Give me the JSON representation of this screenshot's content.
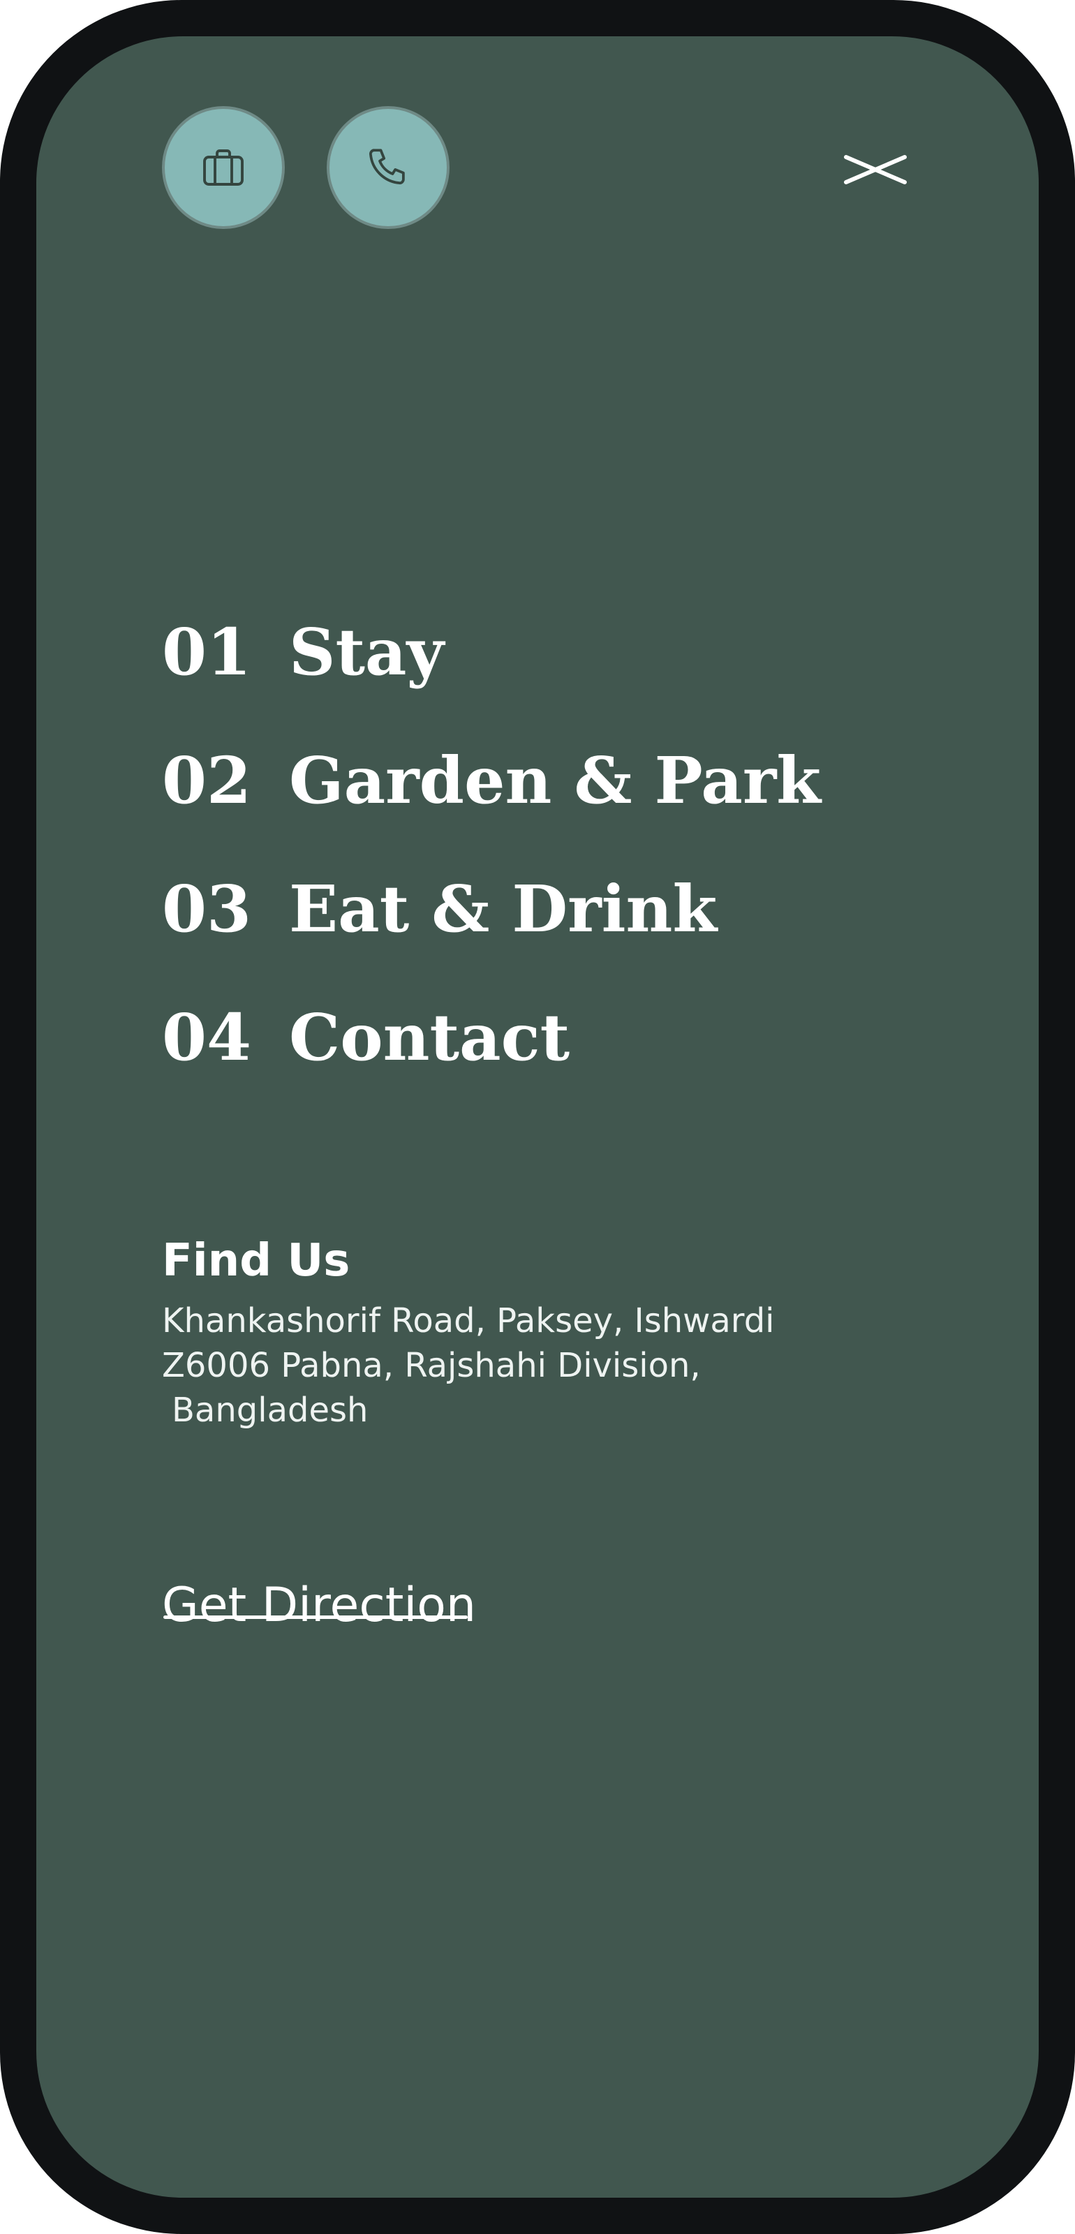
{
  "theme": {
    "frame_color": "#101214",
    "background": "#41574f",
    "button_color": "#86b8b6",
    "icon_stroke": "#34453f",
    "text_color": "#ffffff"
  },
  "header": {
    "left_icons": [
      {
        "icon": "briefcase-icon"
      },
      {
        "icon": "phone-icon"
      }
    ],
    "close_icon": "close-icon"
  },
  "menu": {
    "items": [
      {
        "number": "01",
        "label": "Stay"
      },
      {
        "number": "02",
        "label": "Garden & Park"
      },
      {
        "number": "03",
        "label": "Eat & Drink"
      },
      {
        "number": "04",
        "label": "Contact"
      }
    ]
  },
  "find_us": {
    "title": "Find Us",
    "address_lines": [
      "Khankashorif Road, Paksey, Ishwardi",
      "Z6006 Pabna, Rajshahi Division,",
      "Bangladesh"
    ],
    "link_label": "Get Direction"
  }
}
